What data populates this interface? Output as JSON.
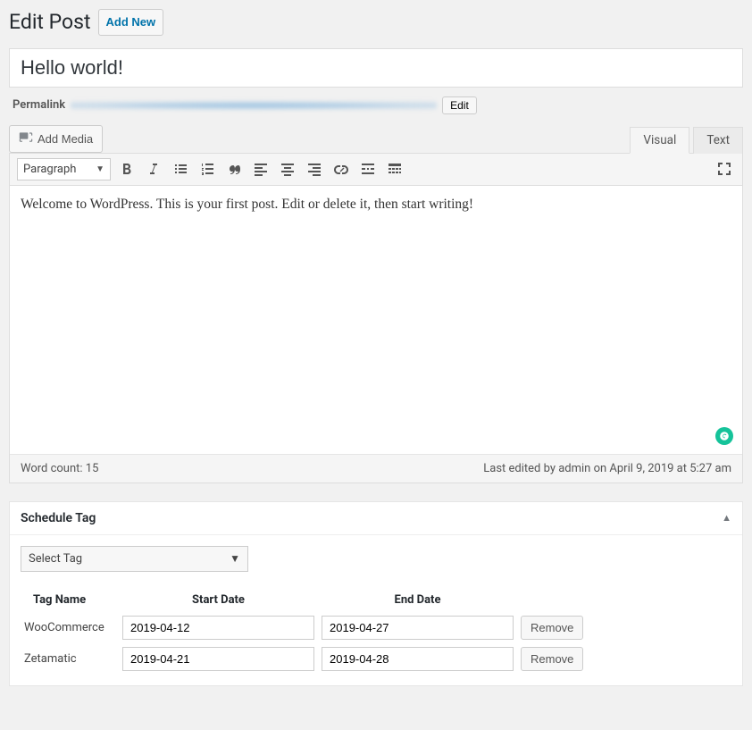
{
  "header": {
    "page_title": "Edit Post",
    "add_new_label": "Add New"
  },
  "post": {
    "title": "Hello world!",
    "permalink_label": "Permalink",
    "permalink_edit_label": "Edit"
  },
  "media": {
    "add_media_label": "Add Media"
  },
  "editor": {
    "tabs": {
      "visual": "Visual",
      "text": "Text"
    },
    "format_selected": "Paragraph",
    "body": "Welcome to WordPress. This is your first post. Edit or delete it, then start writing!",
    "word_count_label": "Word count: 15",
    "last_edited": "Last edited by admin on April 9, 2019 at 5:27 am"
  },
  "schedule": {
    "title": "Schedule Tag",
    "select_placeholder": "Select Tag",
    "columns": {
      "name": "Tag Name",
      "start": "Start Date",
      "end": "End Date"
    },
    "remove_label": "Remove",
    "rows": [
      {
        "name": "WooCommerce",
        "start": "2019-04-12",
        "end": "2019-04-27"
      },
      {
        "name": "Zetamatic",
        "start": "2019-04-21",
        "end": "2019-04-28"
      }
    ]
  }
}
